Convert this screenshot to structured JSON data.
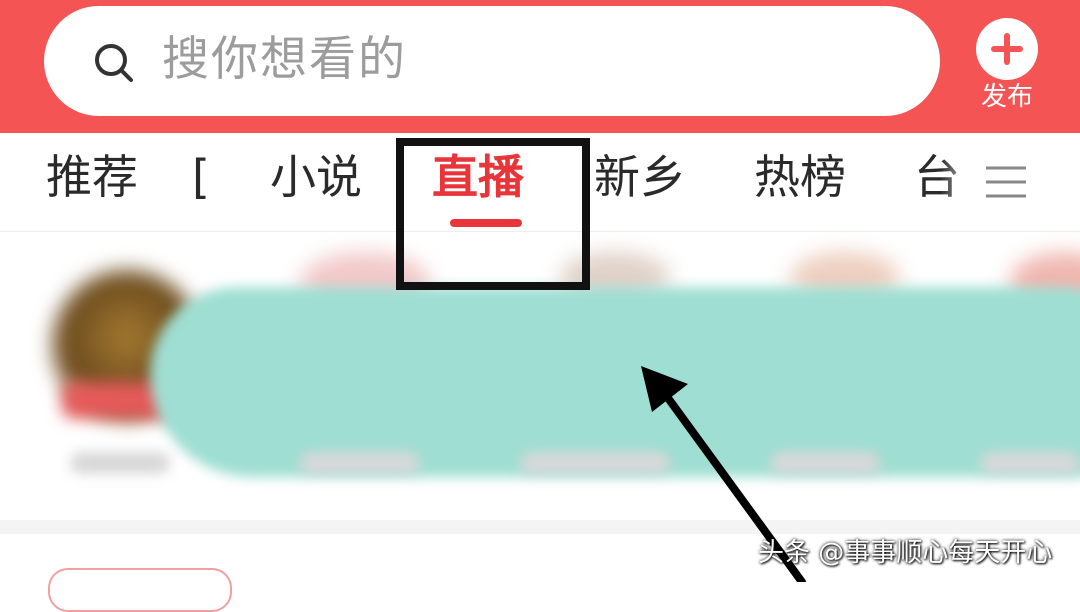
{
  "search": {
    "placeholder": "搜你想看的"
  },
  "publish": {
    "label": "发布"
  },
  "tabs": [
    {
      "label": "推荐",
      "active": false
    },
    {
      "label": "[",
      "active": false
    },
    {
      "label": "小说",
      "active": false
    },
    {
      "label": "直播",
      "active": true
    },
    {
      "label": "新乡",
      "active": false
    },
    {
      "label": "热榜",
      "active": false
    },
    {
      "label": "台",
      "active": false
    }
  ],
  "watermark": "头条 @事事顺心每天开心",
  "colors": {
    "header": "#f55454",
    "accent": "#e8353a",
    "blob": "#9fded2"
  },
  "icons": {
    "search": "search-icon",
    "publish": "plus-icon",
    "menu": "hamburger-menu-icon"
  }
}
